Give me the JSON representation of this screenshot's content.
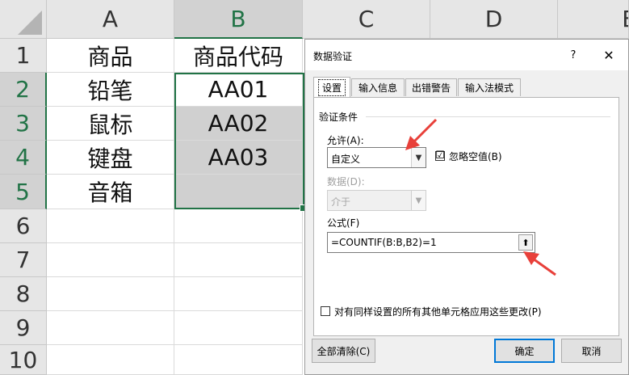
{
  "spreadsheet": {
    "columns": [
      "A",
      "B",
      "C",
      "D",
      "E"
    ],
    "rows": [
      "1",
      "2",
      "3",
      "4",
      "5",
      "6",
      "7",
      "8",
      "9",
      "10"
    ],
    "col_a": [
      "商品",
      "铅笔",
      "鼠标",
      "键盘",
      "音箱"
    ],
    "col_b": [
      "商品代码",
      "AA01",
      "AA02",
      "AA03",
      ""
    ]
  },
  "dialog": {
    "title": "数据验证",
    "help": "?",
    "close": "✕",
    "tabs": [
      "设置",
      "输入信息",
      "出错警告",
      "输入法模式"
    ],
    "group_label": "验证条件",
    "allow_label": "允许(A):",
    "allow_value": "自定义",
    "ignore_blank_label": "忽略空值(B)",
    "ignore_blank_checked": "☑",
    "data_label": "数据(D):",
    "data_value": "介于",
    "formula_label": "公式(F)",
    "formula_value": "=COUNTIF(B:B,B2)=1",
    "apply_all_label": "对有同样设置的所有其他单元格应用这些更改(P)",
    "clear_all": "全部清除(C)",
    "ok": "确定",
    "cancel": "取消"
  },
  "colors": {
    "annotation_arrow": "#e8403a",
    "excel_green": "#217346",
    "default_button_border": "#0078d7"
  }
}
